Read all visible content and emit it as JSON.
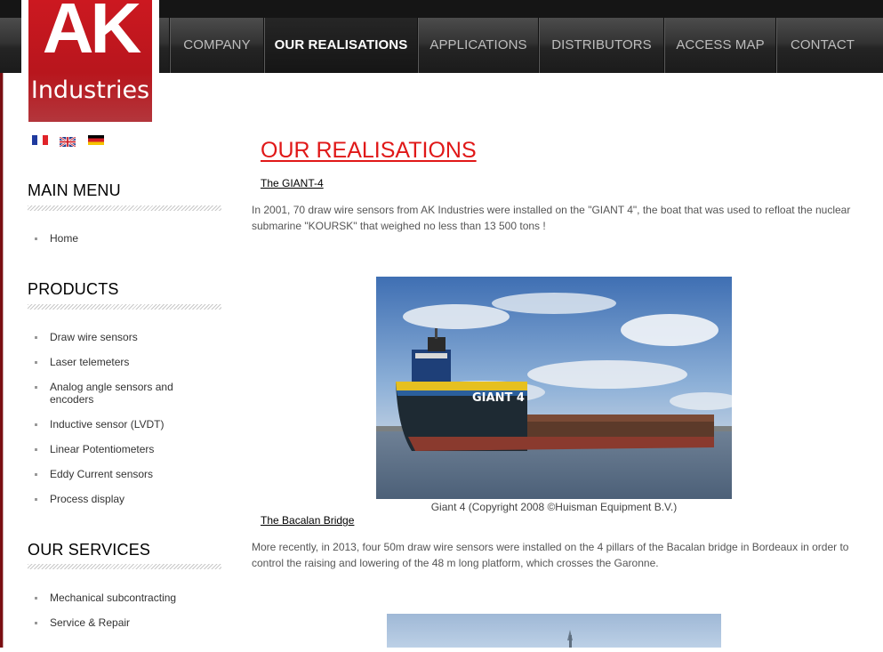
{
  "logo": {
    "mark": "AK",
    "name": "Industries"
  },
  "nav": {
    "items": [
      {
        "label": "COMPANY"
      },
      {
        "label": "OUR REALISATIONS"
      },
      {
        "label": "APPLICATIONS"
      },
      {
        "label": "DISTRIBUTORS"
      },
      {
        "label": "ACCESS MAP"
      },
      {
        "label": "CONTACT"
      }
    ],
    "active": "OUR REALISATIONS"
  },
  "languages": [
    "flag-fr",
    "flag-uk",
    "flag-de"
  ],
  "sidebar": {
    "main_menu": {
      "title": "MAIN MENU",
      "items": [
        "Home"
      ]
    },
    "products": {
      "title": "PRODUCTS",
      "items": [
        "Draw wire sensors",
        "Laser telemeters",
        "Analog angle sensors and",
        "encoders",
        "Inductive sensor (LVDT)",
        "Linear Potentiometers",
        "Eddy Current sensors",
        "Process display"
      ]
    },
    "services": {
      "title": "OUR SERVICES",
      "items": [
        "Mechanical subcontracting",
        "Service & Repair"
      ]
    }
  },
  "main": {
    "title": "OUR REALISATIONS",
    "sections": [
      {
        "link": "The GIANT-4",
        "text": "In 2001, 70 draw wire sensors from AK Industries were installed on the \"GIANT 4\", the boat that was used to refloat the nuclear",
        "text2": "submarine \"KOURSK\" that weighed no less than 13 500 tons !",
        "photo_label": "GIANT 4",
        "caption": "Giant 4 (Copyright 2008 ©Huisman Equipment B.V.)"
      },
      {
        "link": "The Bacalan Bridge",
        "text": "More recently, in 2013, four 50m draw wire sensors were installed on the 4 pillars of the Bacalan bridge in Bordeaux in order to",
        "text2": "control the raising and lowering of the 48 m long platform, which crosses the Garonne."
      }
    ]
  }
}
